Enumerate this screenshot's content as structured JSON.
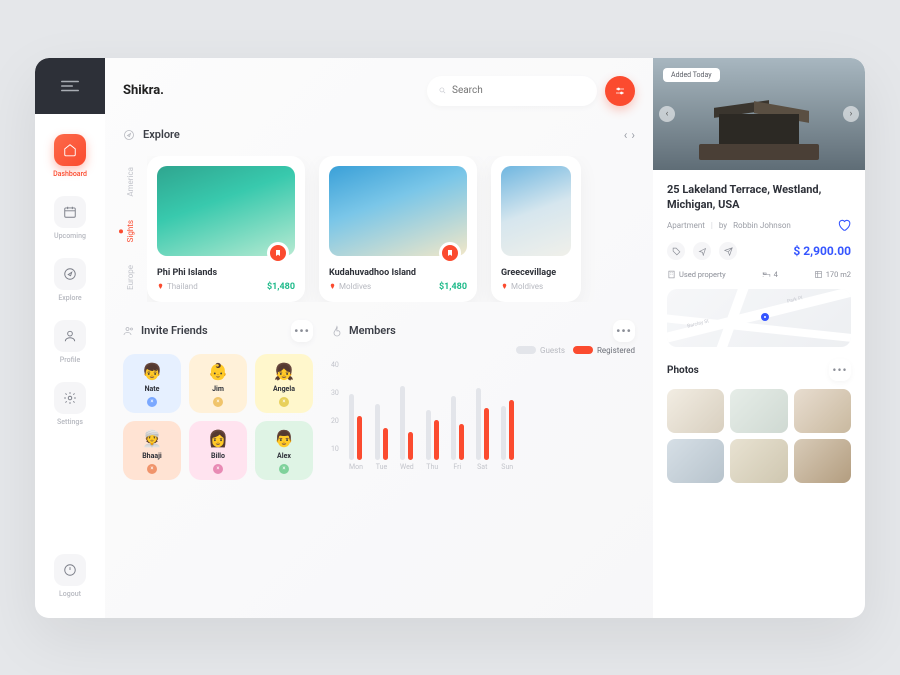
{
  "brand": "Shikra.",
  "search": {
    "placeholder": "Search"
  },
  "sidebar": {
    "items": [
      {
        "label": "Dashboard"
      },
      {
        "label": "Upcoming"
      },
      {
        "label": "Explore"
      },
      {
        "label": "Profile"
      },
      {
        "label": "Settings"
      }
    ],
    "logout": "Logout"
  },
  "explore": {
    "title": "Explore",
    "tabs": [
      "America",
      "Sights",
      "Europe"
    ],
    "cards": [
      {
        "title": "Phi Phi Islands",
        "location": "Thailand",
        "price": "$1,480"
      },
      {
        "title": "Kudahuvadhoo Island",
        "location": "Moldives",
        "price": "$1,480"
      },
      {
        "title": "Greecevillage",
        "location": "Moldives",
        "price": ""
      }
    ]
  },
  "invite": {
    "title": "Invite Friends",
    "friends": [
      {
        "name": "Nate",
        "emoji": "👦",
        "class": "f-blue"
      },
      {
        "name": "Jim",
        "emoji": "👶",
        "class": "f-amber"
      },
      {
        "name": "Angela",
        "emoji": "👧",
        "class": "f-yellow"
      },
      {
        "name": "Bhaaji",
        "emoji": "👳",
        "class": "f-orange"
      },
      {
        "name": "Billo",
        "emoji": "👩",
        "class": "f-pink"
      },
      {
        "name": "Alex",
        "emoji": "👨",
        "class": "f-green"
      }
    ]
  },
  "members": {
    "title": "Members",
    "legend": {
      "guests": "Guests",
      "registered": "Registered"
    }
  },
  "chart_data": {
    "type": "bar",
    "categories": [
      "Mon",
      "Tue",
      "Wed",
      "Thu",
      "Fri",
      "Sat",
      "Sun"
    ],
    "series": [
      {
        "name": "Guests",
        "values": [
          33,
          28,
          37,
          25,
          32,
          36,
          27
        ]
      },
      {
        "name": "Registered",
        "values": [
          22,
          16,
          14,
          20,
          18,
          26,
          30
        ]
      }
    ],
    "ylim": [
      0,
      40
    ],
    "yticks": [
      40,
      30,
      20,
      10
    ],
    "title": "Members",
    "xlabel": "",
    "ylabel": ""
  },
  "listing": {
    "tag": "Added Today",
    "address": "25 Lakeland Terrace, Westland, Michigan, USA",
    "type": "Apartment",
    "by_prefix": "by",
    "owner": "Robbin Johnson",
    "price": "$ 2,900.00",
    "specs": {
      "used": "Used property",
      "beds": "4",
      "area": "170 m2"
    },
    "map": {
      "street1": "Barclay St",
      "street2": "Park Pl"
    },
    "photos_title": "Photos"
  }
}
